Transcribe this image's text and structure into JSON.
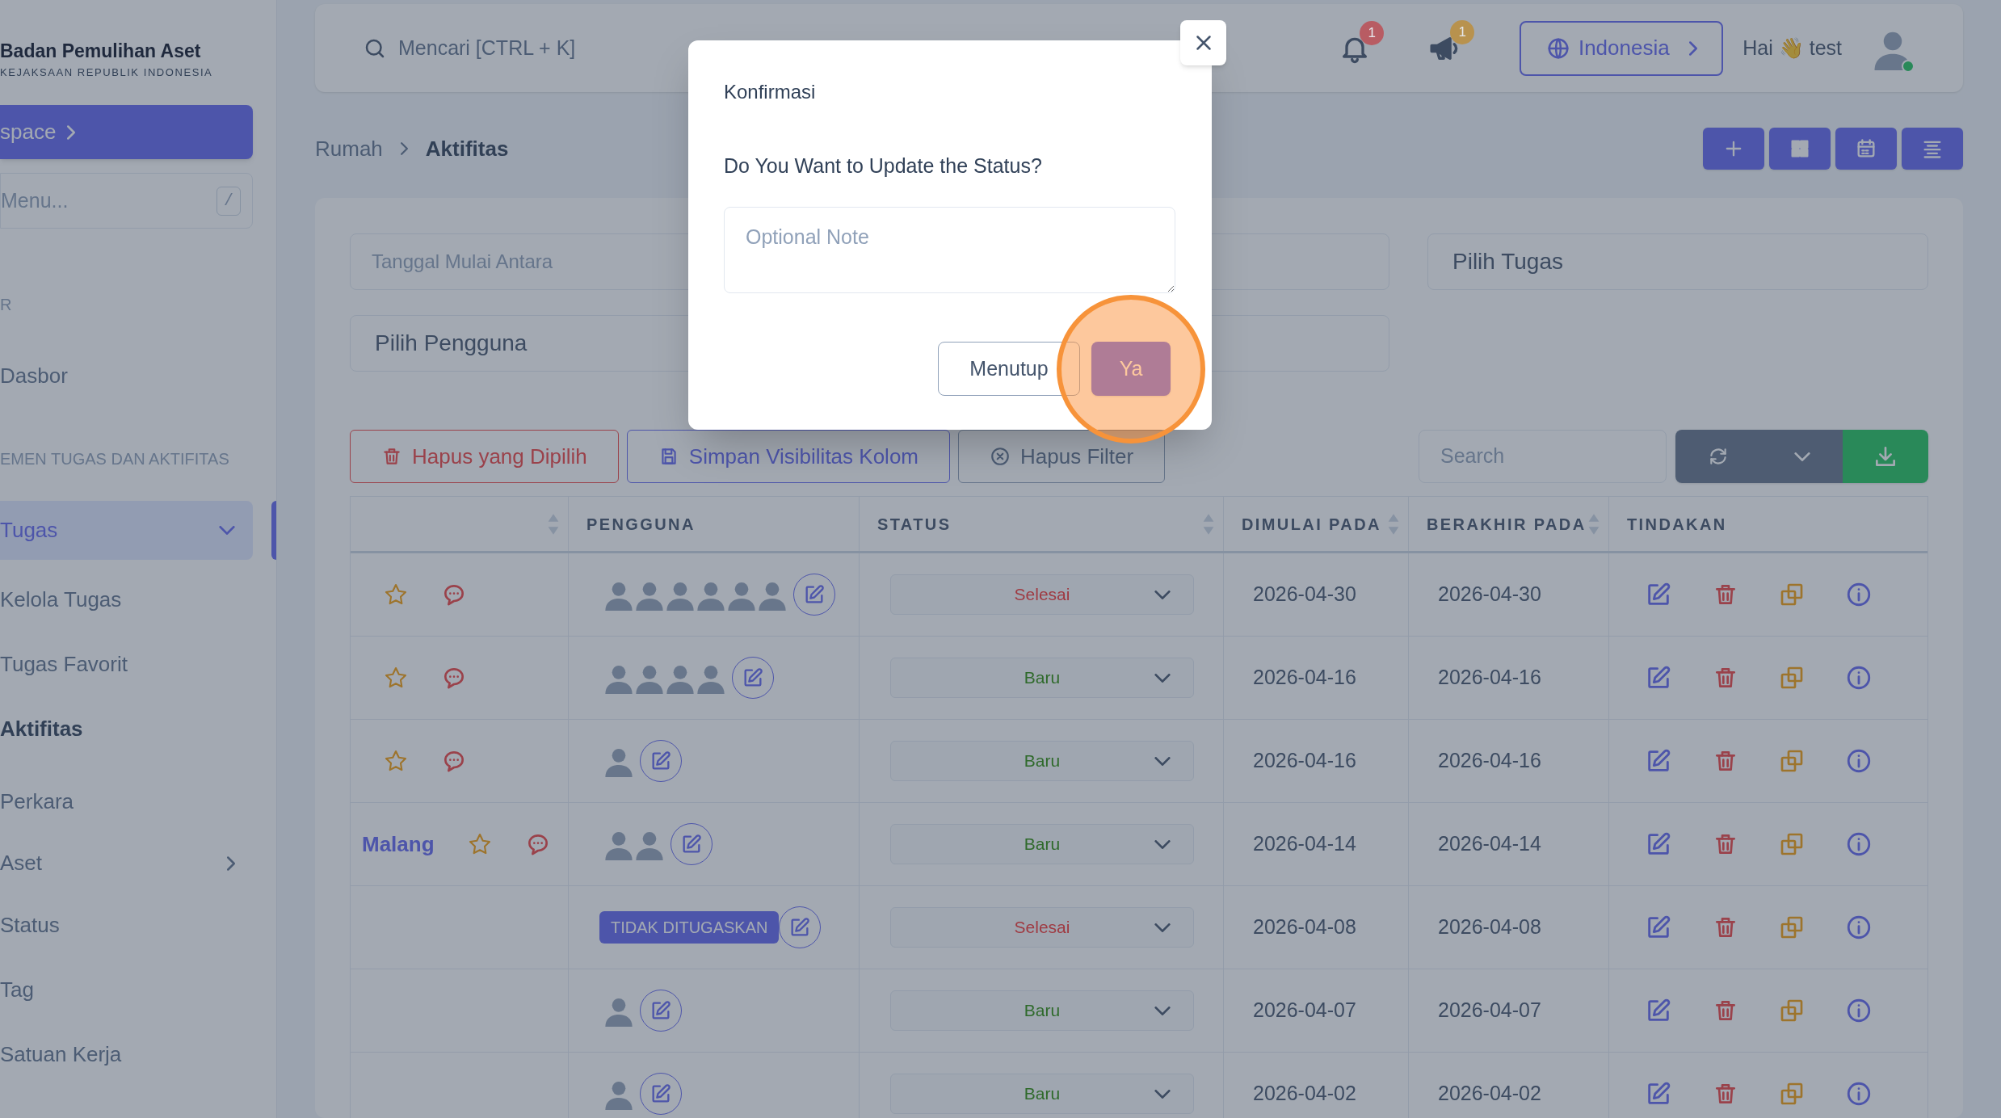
{
  "sidebar": {
    "brand_title": "Badan Pemulihan Aset",
    "brand_subtitle": "KEJAKSAAN REPUBLIK INDONESIA",
    "workspace_button": "space",
    "menu_search": {
      "placeholder": "Menu...",
      "shortcut": "/"
    },
    "sections": [
      {
        "heading": "R",
        "items": [
          {
            "kind": "link",
            "label": "Dasbor",
            "selected": false
          }
        ]
      },
      {
        "heading": "EMEN TUGAS DAN AKTIFITAS",
        "items": [
          {
            "kind": "group",
            "label": "Tugas",
            "selected": true,
            "expanded": true,
            "children": [
              {
                "kind": "link",
                "label": "Kelola Tugas",
                "selected": false
              },
              {
                "kind": "link",
                "label": "Tugas Favorit",
                "selected": false
              },
              {
                "kind": "link",
                "label": "Aktifitas",
                "selected": true
              }
            ]
          },
          {
            "kind": "link",
            "label": "Perkara",
            "selected": false
          },
          {
            "kind": "group",
            "label": "Aset",
            "selected": false,
            "expanded": false
          },
          {
            "kind": "link",
            "label": "Status",
            "selected": false
          },
          {
            "kind": "link",
            "label": "Tag",
            "selected": false
          },
          {
            "kind": "link",
            "label": "Satuan Kerja",
            "selected": false
          }
        ]
      }
    ]
  },
  "header": {
    "search_placeholder": "Mencari [CTRL + K]",
    "notifications": [
      {
        "kind": "bell",
        "count": "1",
        "color": "#b85c63"
      },
      {
        "kind": "megaphone",
        "count": "1",
        "color": "#b8924e"
      }
    ],
    "language": "Indonesia",
    "greeting": "Hai 👋 test",
    "user_online": true
  },
  "breadcrumb": [
    {
      "label": "Rumah",
      "current": false
    },
    {
      "label": "Aktifitas",
      "current": true
    }
  ],
  "view_buttons": [
    {
      "kind": "add"
    },
    {
      "kind": "grid"
    },
    {
      "kind": "calendar"
    },
    {
      "kind": "list"
    }
  ],
  "filters": [
    {
      "kind": "date",
      "placeholder": "Tanggal Mulai Antara"
    },
    {
      "kind": "select"
    },
    {
      "kind": "select",
      "placeholder": "Pilih Tugas"
    },
    {
      "kind": "select",
      "placeholder": "Pilih Pengguna"
    },
    {
      "kind": "select"
    }
  ],
  "actions": [
    {
      "kind": "danger",
      "label": "Hapus yang Dipilih"
    },
    {
      "kind": "primary",
      "label": "Simpan Visibilitas Kolom"
    },
    {
      "kind": "neutral",
      "label": "Hapus Filter"
    }
  ],
  "table": {
    "search_placeholder": "Search",
    "columns": [
      {
        "sortable": true
      },
      {
        "label": "PENGGUNA",
        "sortable": false
      },
      {
        "label": "STATUS",
        "sortable": true
      },
      {
        "label": "DIMULAI PADA",
        "sortable": true
      },
      {
        "label": "BERAKHIR PADA",
        "sortable": true
      },
      {
        "label": "TINDAKAN",
        "sortable": false
      }
    ],
    "rows": [
      {
        "favorite": false,
        "assignees": [
          {
            "kind": "avatar"
          },
          {
            "kind": "avatar"
          },
          {
            "kind": "avatar"
          },
          {
            "kind": "avatar"
          },
          {
            "kind": "avatar"
          },
          {
            "kind": "avatar"
          }
        ],
        "status": {
          "label": "Selesai",
          "color": "#9f3a42"
        },
        "start": "2026-04-30",
        "end": "2026-04-30"
      },
      {
        "favorite": false,
        "assignees": [
          {
            "kind": "avatar"
          },
          {
            "kind": "avatar"
          },
          {
            "kind": "avatar"
          },
          {
            "kind": "avatar"
          }
        ],
        "status": {
          "label": "Baru",
          "color": "#2f6a2b"
        },
        "start": "2026-04-16",
        "end": "2026-04-16"
      },
      {
        "favorite": false,
        "assignees": [
          {
            "kind": "avatar"
          }
        ],
        "status": {
          "label": "Baru",
          "color": "#2f6a2b"
        },
        "start": "2026-04-16",
        "end": "2026-04-16"
      },
      {
        "title": "Malang",
        "favorite": false,
        "assignees": [
          {
            "kind": "avatar"
          },
          {
            "kind": "avatar"
          }
        ],
        "status": {
          "label": "Baru",
          "color": "#2f6a2b"
        },
        "start": "2026-04-14",
        "end": "2026-04-14"
      },
      {
        "assignees": [
          {
            "kind": "unassigned",
            "label": "TIDAK DITUGASKAN"
          }
        ],
        "status": {
          "label": "Selesai",
          "color": "#9f3a42"
        },
        "start": "2026-04-08",
        "end": "2026-04-08"
      },
      {
        "assignees": [
          {
            "kind": "avatar"
          }
        ],
        "status": {
          "label": "Baru",
          "color": "#2f6a2b"
        },
        "start": "2026-04-07",
        "end": "2026-04-07"
      },
      {
        "assignees": [
          {
            "kind": "avatar"
          }
        ],
        "status": {
          "label": "Baru",
          "color": "#2f6a2b"
        },
        "start": "2026-04-02",
        "end": "2026-04-02"
      }
    ]
  },
  "modal": {
    "title": "Konfirmasi",
    "message": "Do You Want to Update the Status?",
    "note_placeholder": "Optional Note",
    "buttons": [
      {
        "kind": "secondary",
        "label": "Menutup",
        "highlighted": false
      },
      {
        "kind": "primary",
        "label": "Ya",
        "highlighted": true
      }
    ]
  }
}
